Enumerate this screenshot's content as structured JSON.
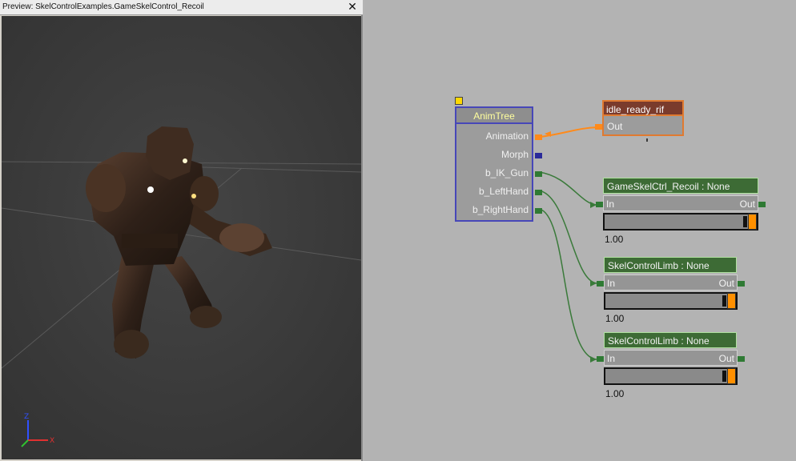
{
  "preview": {
    "title": "Preview: SkelControlExamples.GameSkelControl_Recoil",
    "close_glyph": "✕",
    "axis": {
      "x": "X",
      "z": "Z"
    }
  },
  "graph": {
    "animtree": {
      "title": "AnimTree",
      "pins": [
        "Animation",
        "Morph",
        "b_IK_Gun",
        "b_LeftHand",
        "b_RightHand"
      ]
    },
    "sequence_node": {
      "title": "idle_ready_rif",
      "out_label": "Out"
    },
    "skel_nodes": [
      {
        "title": "GameSkelCtrl_Recoil : None",
        "in_label": "In",
        "out_label": "Out",
        "weight": "1.00",
        "strength": 1.0
      },
      {
        "title": "SkelControlLimb : None",
        "in_label": "In",
        "out_label": "Out",
        "weight": "1.00",
        "strength": 1.0
      },
      {
        "title": "SkelControlLimb : None",
        "in_label": "In",
        "out_label": "Out",
        "weight": "1.00",
        "strength": 1.0
      }
    ]
  },
  "colors": {
    "graph_bg": "#b3b3b3",
    "animtree_border": "#4747b8",
    "sequence_border": "#e07a30",
    "skel_title_bg": "#3d6b35",
    "wire_green": "#3a7a3a",
    "wire_orange": "#ff8a1a",
    "selector_yellow": "#ffd800"
  }
}
